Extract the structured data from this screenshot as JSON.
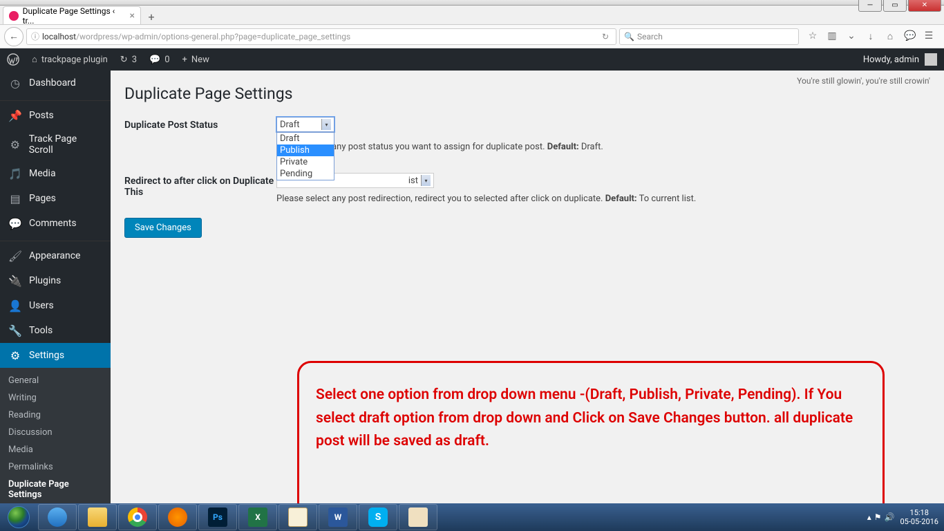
{
  "window": {
    "tab_title": "Duplicate Page Settings ‹ tr...",
    "url_host": "localhost",
    "url_path": "/wordpress/wp-admin/options-general.php?page=duplicate_page_settings",
    "search_placeholder": "Search"
  },
  "wpbar": {
    "site": "trackpage plugin",
    "updates": "3",
    "comments": "0",
    "new": "New",
    "howdy": "Howdy, admin"
  },
  "sidebar": {
    "items": [
      {
        "icon": "dashboard",
        "label": "Dashboard"
      },
      {
        "icon": "pin",
        "label": "Posts"
      },
      {
        "icon": "gear",
        "label": "Track Page Scroll"
      },
      {
        "icon": "media",
        "label": "Media"
      },
      {
        "icon": "page",
        "label": "Pages"
      },
      {
        "icon": "comment",
        "label": "Comments"
      },
      {
        "icon": "brush",
        "label": "Appearance"
      },
      {
        "icon": "plug",
        "label": "Plugins"
      },
      {
        "icon": "user",
        "label": "Users"
      },
      {
        "icon": "wrench",
        "label": "Tools"
      },
      {
        "icon": "sliders",
        "label": "Settings"
      }
    ],
    "submenu": [
      "General",
      "Writing",
      "Reading",
      "Discussion",
      "Media",
      "Permalinks",
      "Duplicate Page Settings"
    ]
  },
  "content": {
    "glow": "You're still glowin', you're still crowin'",
    "heading": "Duplicate Page Settings",
    "row1_label": "Duplicate Post Status",
    "row1_selected": "Draft",
    "row1_options": [
      "Draft",
      "Publish",
      "Private",
      "Pending"
    ],
    "row1_desc_pre": "any post status you want to assign for duplicate post. ",
    "row1_default_label": "Default:",
    "row1_default_val": " Draft.",
    "row2_label": "Redirect to after click on Duplicate This",
    "row2_selected_suffix": "ist",
    "row2_desc": "Please select any post redirection, redirect you to selected after click on duplicate. ",
    "row2_default_label": "Default:",
    "row2_default_val": " To current list.",
    "save": "Save Changes",
    "annotation": "Select one option from drop down menu -(Draft, Publish, Private, Pending). If You select draft option from  drop down  and Click on Save Changes button. all duplicate post will be saved as draft."
  },
  "taskbar": {
    "time": "15:18",
    "date": "05-05-2016"
  }
}
